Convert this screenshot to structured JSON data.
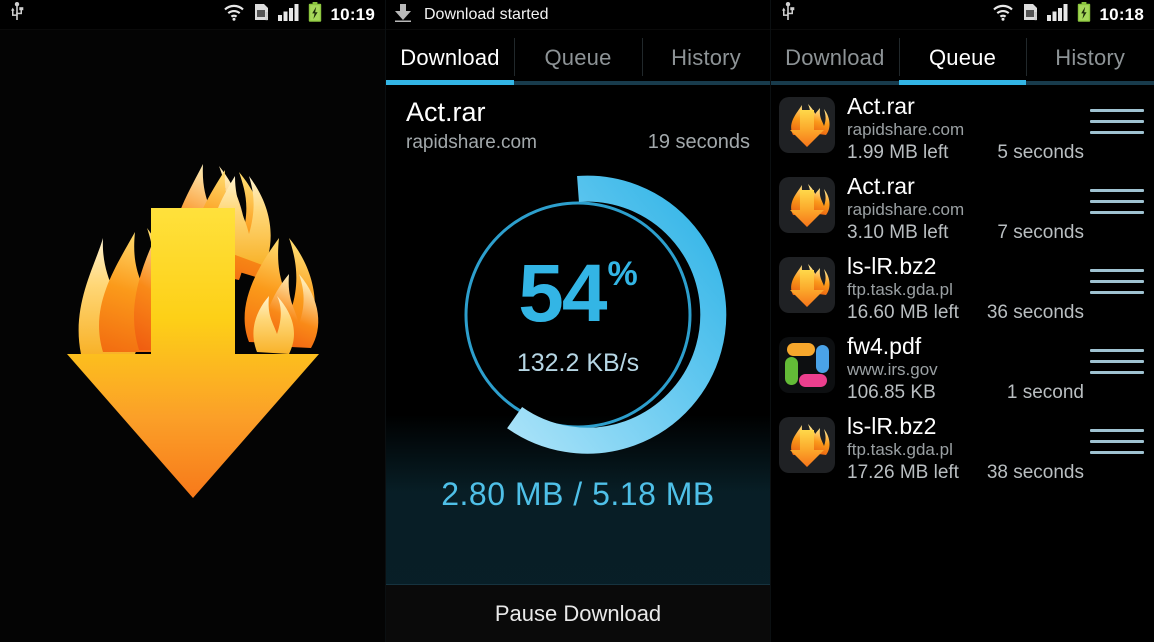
{
  "left_panel": {
    "statusbar": {
      "time": "10:19",
      "icons": [
        "usb-icon",
        "wifi-icon",
        "sim-card-icon",
        "signal-bars-icon",
        "battery-charging-icon"
      ]
    },
    "logo": {
      "name": "flame-download-arrow-logo",
      "description": "Downward arrow engulfed in flames"
    }
  },
  "middle_panel": {
    "notification": {
      "icon": "download-arrow-icon",
      "text": "Download started"
    },
    "tabs": [
      {
        "label": "Download",
        "active": true
      },
      {
        "label": "Queue",
        "active": false
      },
      {
        "label": "History",
        "active": false
      }
    ],
    "download": {
      "filename": "Act.rar",
      "host": "rapidshare.com",
      "eta": "19 seconds",
      "percent": "54",
      "percent_symbol": "%",
      "speed": "132.2 KB/s",
      "totals": "2.80 MB / 5.18 MB",
      "progress_value": 54,
      "accent_color": "#33b5e5"
    },
    "pause_button": {
      "label": "Pause Download"
    }
  },
  "right_panel": {
    "statusbar": {
      "time": "10:18",
      "icons": [
        "usb-icon",
        "wifi-icon",
        "sim-card-icon",
        "signal-bars-icon",
        "battery-charging-icon"
      ]
    },
    "tabs": [
      {
        "label": "Download",
        "active": false
      },
      {
        "label": "Queue",
        "active": true
      },
      {
        "label": "History",
        "active": false
      }
    ],
    "queue": [
      {
        "icon": "flame-download-icon",
        "name": "Act.rar",
        "host": "rapidshare.com",
        "size": "1.99 MB left",
        "eta": "5 seconds"
      },
      {
        "icon": "flame-download-icon",
        "name": "Act.rar",
        "host": "rapidshare.com",
        "size": "3.10 MB left",
        "eta": "7 seconds"
      },
      {
        "icon": "flame-download-icon",
        "name": "ls-lR.bz2",
        "host": "ftp.task.gda.pl",
        "size": "16.60 MB left",
        "eta": "36 seconds"
      },
      {
        "icon": "pinwheel-file-icon",
        "name": "fw4.pdf",
        "host": "www.irs.gov",
        "size": "106.85 KB",
        "eta": "1 second"
      },
      {
        "icon": "flame-download-icon",
        "name": "ls-lR.bz2",
        "host": "ftp.task.gda.pl",
        "size": "17.26 MB left",
        "eta": "38 seconds"
      }
    ]
  }
}
